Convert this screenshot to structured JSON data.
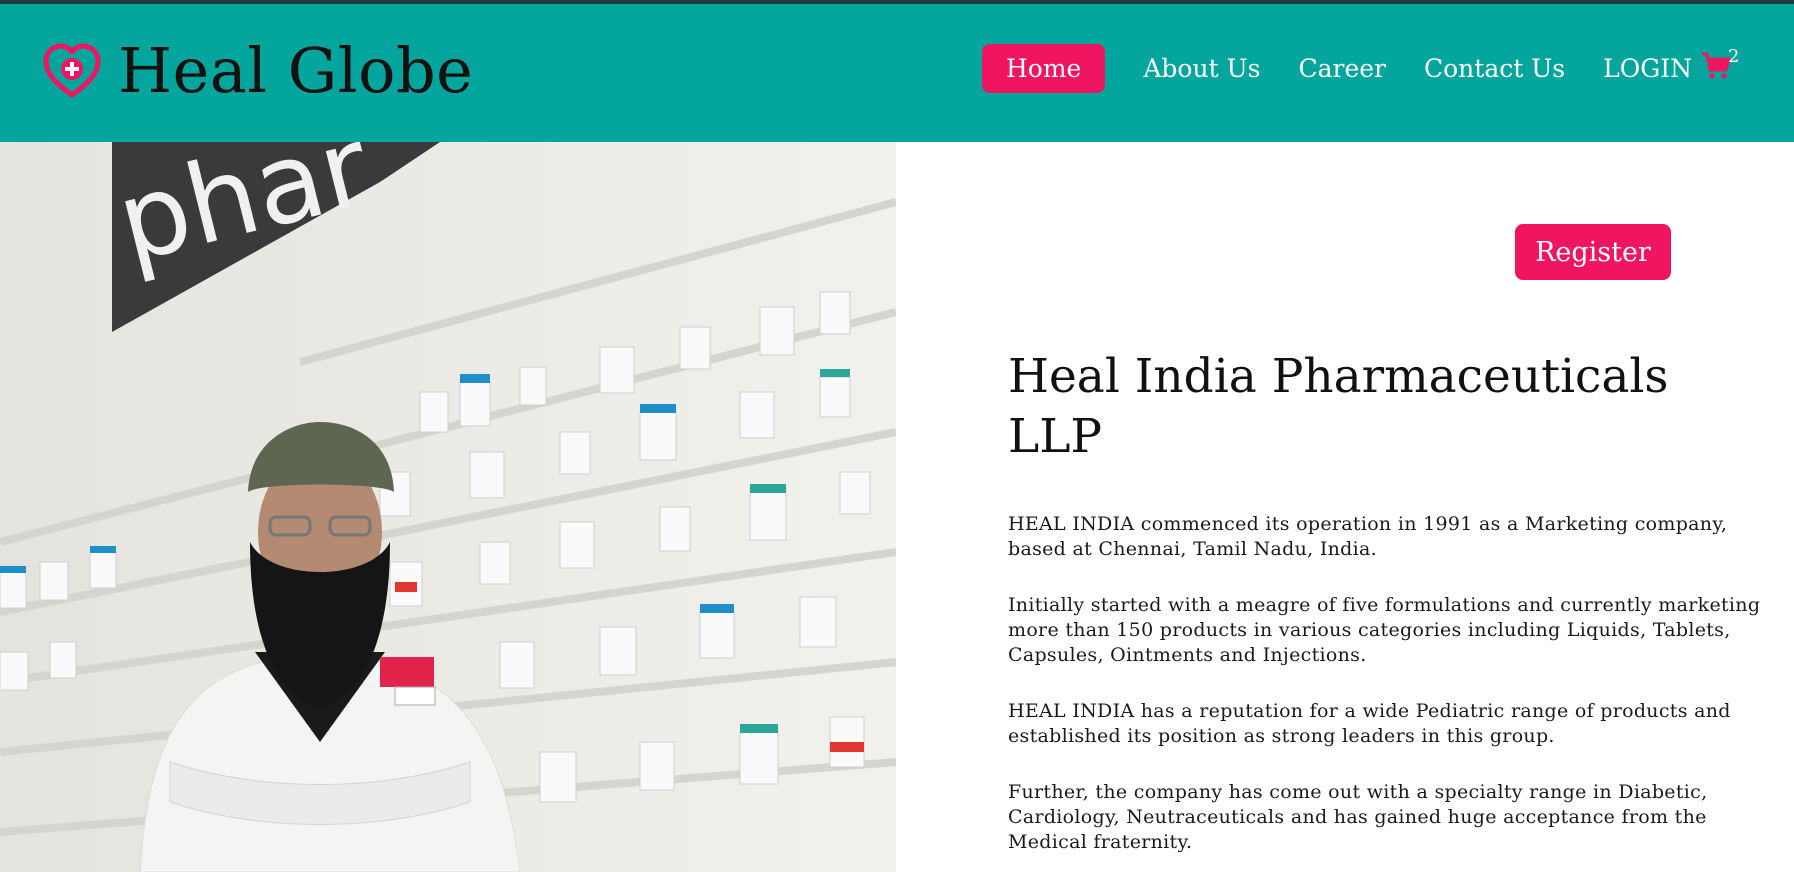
{
  "brand": {
    "name": "Heal Globe",
    "icon": "heart-plus-icon"
  },
  "nav": {
    "items": [
      {
        "label": "Home",
        "active": true
      },
      {
        "label": "About Us",
        "active": false
      },
      {
        "label": "Career",
        "active": false
      },
      {
        "label": "Contact Us",
        "active": false
      },
      {
        "label": "LOGIN",
        "active": false
      }
    ],
    "cart": {
      "icon": "shopping-cart-icon",
      "count": "2"
    }
  },
  "hero": {
    "image": "pharmacist-in-pharmacy-photo"
  },
  "main": {
    "register_label": "Register",
    "title": "Heal India Pharmaceuticals LLP",
    "paragraphs": [
      "HEAL INDIA commenced its operation in 1991 as a Marketing company, based at Chennai, Tamil Nadu, India.",
      "Initially started with a meagre of five formulations and currently marketing more than 150 products in various categories including Liquids, Tablets, Capsules, Ointments and Injections.",
      "HEAL INDIA has a reputation for a wide Pediatric range of products and established its position as strong leaders in this group.",
      "Further, the company has come out with a specialty range in Diabetic, Cardiology, Neutraceuticals and has gained huge acceptance from the Medical fraternity."
    ]
  },
  "colors": {
    "header": "#03a59d",
    "accent": "#ef1560",
    "text": "#111111"
  }
}
